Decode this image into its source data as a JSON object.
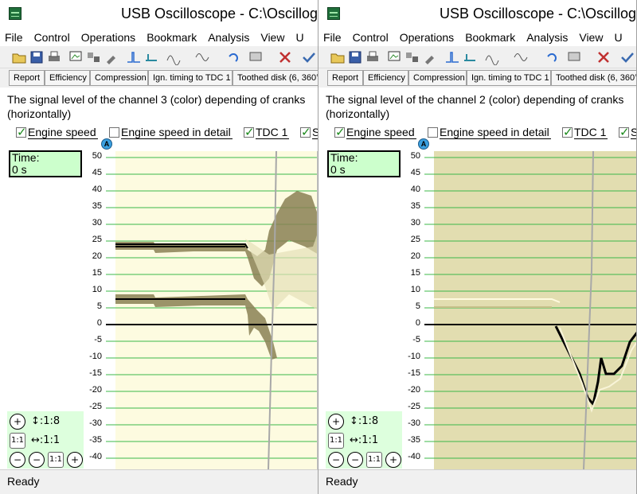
{
  "windows": [
    {
      "title": "USB Oscilloscope - C:\\Oscillogra",
      "menu": [
        "File",
        "Control",
        "Operations",
        "Bookmark",
        "Analysis",
        "View",
        "U"
      ],
      "tabs": [
        "Report",
        "Efficiency",
        "Compression",
        "Ign. timing to TDC 1",
        "Toothed disk (6, 360°"
      ],
      "caption_line1": "The signal level of the channel 3 (color) depending of cranks",
      "caption_line2": "(horizontally)",
      "checkboxes": [
        {
          "label": "Engine speed",
          "checked": true
        },
        {
          "label": "Engine speed in detail",
          "checked": false
        },
        {
          "label": "TDC 1",
          "checked": true
        },
        {
          "label": "S",
          "checked": true
        }
      ],
      "marker": "A",
      "time_label": "Time:",
      "time_value": "0 s",
      "zoom_v": "↕:1:8",
      "zoom_h": "↔:1:1",
      "zoom_one": "1:1",
      "status": "Ready",
      "plot_bg": "#fdfbe0",
      "plot_style": "light"
    },
    {
      "title": "USB Oscilloscope - C:\\Oscillogra",
      "menu": [
        "File",
        "Control",
        "Operations",
        "Bookmark",
        "Analysis",
        "View",
        "U"
      ],
      "tabs": [
        "Report",
        "Efficiency",
        "Compression",
        "Ign. timing to TDC 1",
        "Toothed disk (6, 360°"
      ],
      "caption_line1": "The signal level of the channel 2 (color) depending of cranks",
      "caption_line2": "(horizontally)",
      "checkboxes": [
        {
          "label": "Engine speed",
          "checked": true
        },
        {
          "label": "Engine speed in detail",
          "checked": false
        },
        {
          "label": "TDC 1",
          "checked": true
        },
        {
          "label": "S",
          "checked": true
        }
      ],
      "marker": "A",
      "time_label": "Time:",
      "time_value": "0 s",
      "zoom_v": "↕:1:8",
      "zoom_h": "↔:1:1",
      "zoom_one": "1:1",
      "status": "Ready",
      "plot_bg": "#e2ddb0",
      "plot_style": "dark"
    }
  ],
  "y_axis_ticks": [
    "50",
    "45",
    "40",
    "35",
    "30",
    "25",
    "20",
    "15",
    "10",
    "5",
    "0",
    "-5",
    "-10",
    "-15",
    "-20",
    "-25",
    "-30",
    "-35",
    "-40"
  ],
  "colors": {
    "grid_line": "#3cb84a",
    "zero_line": "#000000",
    "time_box": "#ccffcc",
    "zoom_panel": "#ddffdd"
  }
}
